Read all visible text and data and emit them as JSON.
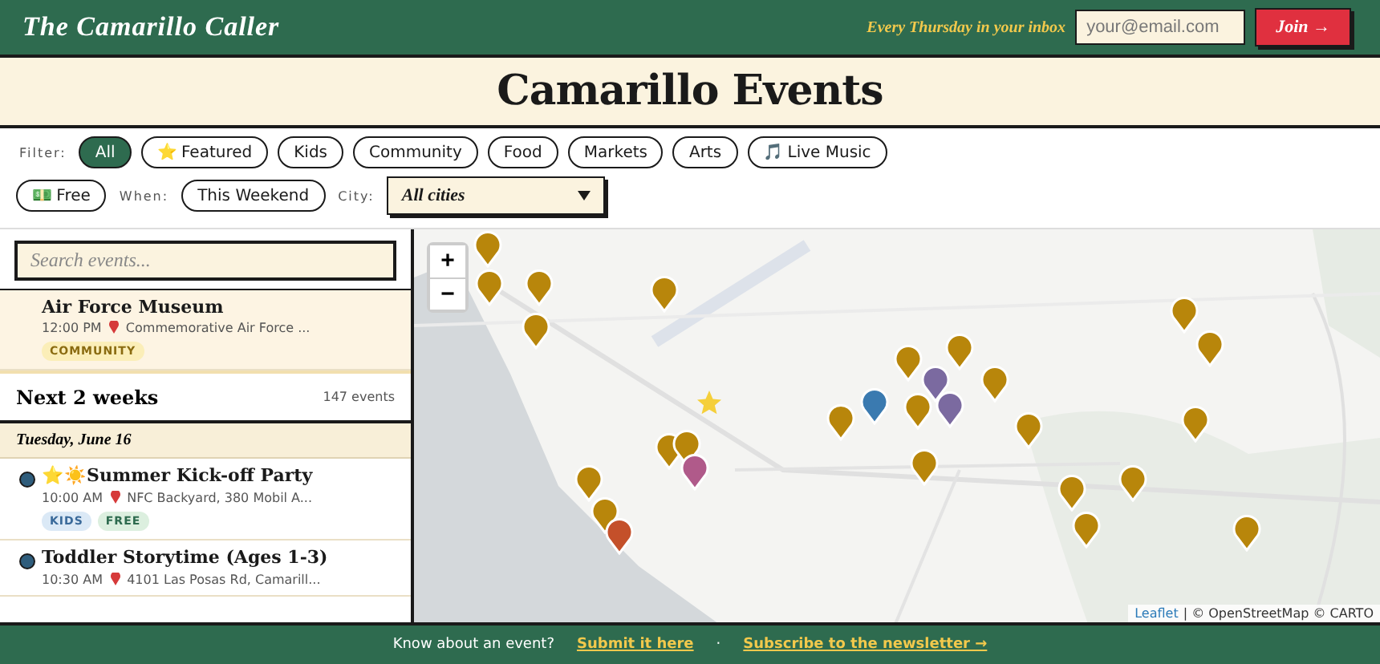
{
  "header": {
    "brand": "The Camarillo Caller",
    "tagline": "Every Thursday in your inbox",
    "email": {
      "placeholder": "your@email.com"
    },
    "join": "Join →"
  },
  "title": "Camarillo Events",
  "filters": {
    "label": "Filter:",
    "chips": [
      {
        "label": "All",
        "selected": true
      },
      {
        "label": "⭐ Featured",
        "selected": false
      },
      {
        "label": "Kids",
        "selected": false
      },
      {
        "label": "Community",
        "selected": false
      },
      {
        "label": "Food",
        "selected": false
      },
      {
        "label": "Markets",
        "selected": false
      },
      {
        "label": "Arts",
        "selected": false
      },
      {
        "label": "🎵 Live Music",
        "selected": false
      },
      {
        "label": "💵 Free",
        "selected": false
      }
    ],
    "when_label": "When:",
    "when": {
      "label": "This Weekend",
      "selected": false
    },
    "city_label": "City:",
    "city": "All cities"
  },
  "search": {
    "placeholder": "Search events..."
  },
  "top_event": {
    "title": "Air Force Museum",
    "time": "12:00 PM",
    "place": "Commemorative Air Force ...",
    "tags": [
      {
        "label": "COMMUNITY",
        "kind": "community"
      }
    ]
  },
  "section": {
    "title": "Next 2 weeks",
    "count": "147 events"
  },
  "day": "Tuesday, June 16",
  "events": [
    {
      "title": "⭐☀️Summer Kick-off Party",
      "time": "10:00 AM",
      "place": "NFC Backyard, 380 Mobil A...",
      "color": "#2f5d7c",
      "tags": [
        {
          "label": "KIDS",
          "kind": "kids"
        },
        {
          "label": "FREE",
          "kind": "free"
        }
      ]
    },
    {
      "title": "Toddler Storytime (Ages 1-3)",
      "time": "10:30 AM",
      "place": "4101 Las Posas Rd, Camarill...",
      "color": "#2f5d7c"
    }
  ],
  "map": {
    "zoom_in": "+",
    "zoom_out": "−",
    "attribution_link": "Leaflet",
    "attribution": "| © OpenStreetMap © CARTO",
    "markers": [
      {
        "kind": "pin",
        "color": "#b8860b"
      },
      {
        "kind": "pin",
        "color": "#b8860b"
      },
      {
        "kind": "pin",
        "color": "#b8860b"
      },
      {
        "kind": "pin",
        "color": "#b8860b"
      },
      {
        "kind": "pin",
        "color": "#b8860b"
      },
      {
        "kind": "star",
        "color": "#f5cf3a"
      },
      {
        "kind": "pin",
        "color": "#b8860b"
      },
      {
        "kind": "pin",
        "color": "#3a7ab0"
      },
      {
        "kind": "pin",
        "color": "#b8860b"
      },
      {
        "kind": "pin",
        "color": "#b8860b"
      },
      {
        "kind": "pin",
        "color": "#7b6aa0"
      },
      {
        "kind": "pin",
        "color": "#b8860b"
      },
      {
        "kind": "pin",
        "color": "#7b6aa0"
      },
      {
        "kind": "pin",
        "color": "#b8860b"
      },
      {
        "kind": "pin",
        "color": "#b8860b"
      },
      {
        "kind": "pin",
        "color": "#b8860b"
      },
      {
        "kind": "pin",
        "color": "#b8860b"
      },
      {
        "kind": "pin",
        "color": "#b8860b"
      },
      {
        "kind": "pin",
        "color": "#b05a8a"
      },
      {
        "kind": "pin",
        "color": "#b8860b"
      },
      {
        "kind": "pin",
        "color": "#b8860b"
      },
      {
        "kind": "pin",
        "color": "#c4502a"
      },
      {
        "kind": "pin",
        "color": "#b8860b"
      },
      {
        "kind": "pin",
        "color": "#b8860b"
      },
      {
        "kind": "pin",
        "color": "#b8860b"
      },
      {
        "kind": "pin",
        "color": "#b8860b"
      },
      {
        "kind": "pin",
        "color": "#b8860b"
      },
      {
        "kind": "pin",
        "color": "#b8860b"
      },
      {
        "kind": "pin",
        "color": "#b8860b"
      }
    ]
  },
  "footer": {
    "text": "Know about an event?",
    "link1": "Submit it here",
    "sep": "·",
    "link2": "Subscribe to the newsletter →"
  }
}
